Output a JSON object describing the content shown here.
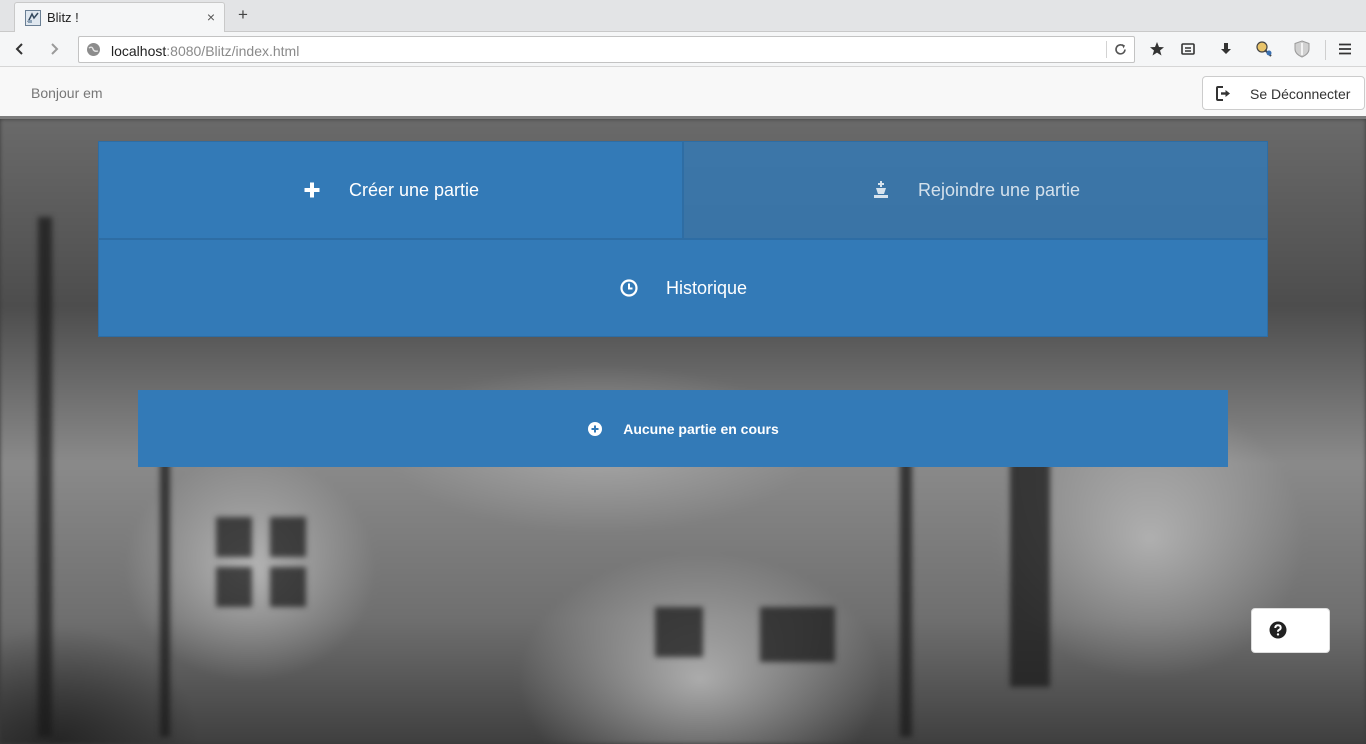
{
  "browser": {
    "tab_title": "Blitz !",
    "tab_close": "×",
    "new_tab": "+",
    "url_host": "localhost",
    "url_rest": ":8080/Blitz/index.html"
  },
  "header": {
    "greeting": "Bonjour em",
    "logout_label": "Se Déconnecter"
  },
  "menu": {
    "create_label": "Créer une partie",
    "join_label": "Rejoindre une partie",
    "history_label": "Historique"
  },
  "games": {
    "empty_label": "Aucune partie en cours"
  },
  "colors": {
    "primary": "#337ab7",
    "primary_border": "#2e6da4",
    "header_bg": "#f8f8f8"
  }
}
